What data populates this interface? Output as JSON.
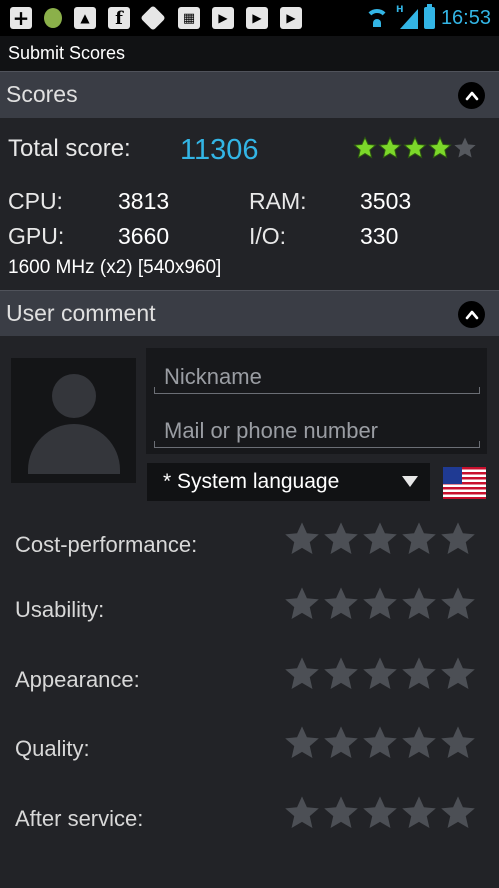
{
  "status_bar": {
    "clock": "16:53",
    "network_label": "H",
    "icons": [
      "plus-icon",
      "android-icon",
      "image-icon",
      "facebook-icon",
      "diamond-icon",
      "grid-icon",
      "play-store-icon",
      "play-store-icon",
      "play-store-icon",
      "wifi-icon",
      "signal-icon",
      "battery-icon"
    ],
    "accent_color": "#33b5e5"
  },
  "title_bar": {
    "title": "Submit Scores"
  },
  "scores_section": {
    "header": "Scores",
    "total_label": "Total score:",
    "total_value": "11306",
    "total_color": "#33b5e5",
    "total_rating": 4,
    "total_rating_max": 5,
    "cpu_label": "CPU:",
    "cpu_value": "3813",
    "ram_label": "RAM:",
    "ram_value": "3503",
    "gpu_label": "GPU:",
    "gpu_value": "3660",
    "io_label": "I/O:",
    "io_value": "330",
    "device_info": "1600 MHz (x2) [540x960]"
  },
  "user_comment_section": {
    "header": "User comment",
    "nickname_placeholder": "Nickname",
    "nickname_value": "",
    "contact_placeholder": "Mail or phone number",
    "contact_value": "",
    "language_selected": "* System language",
    "ratings": [
      {
        "label": "Cost-performance:",
        "value": 0
      },
      {
        "label": "Usability:",
        "value": 0
      },
      {
        "label": "Appearance:",
        "value": 0
      },
      {
        "label": "Quality:",
        "value": 0
      },
      {
        "label": "After service:",
        "value": 0
      }
    ]
  }
}
